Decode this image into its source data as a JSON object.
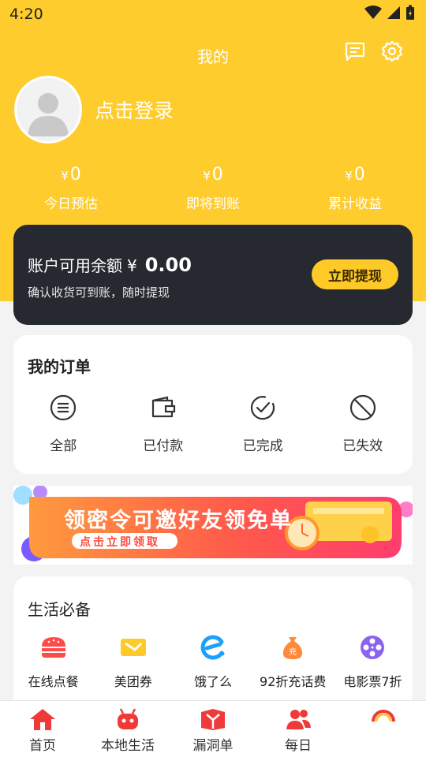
{
  "status_bar": {
    "time": "4:20"
  },
  "header": {
    "title": "我的"
  },
  "user": {
    "login_prompt": "点击登录"
  },
  "stats": [
    {
      "currency": "¥",
      "value": "0",
      "label": "今日预估"
    },
    {
      "currency": "¥",
      "value": "0",
      "label": "即将到账"
    },
    {
      "currency": "¥",
      "value": "0",
      "label": "累计收益"
    }
  ],
  "balance": {
    "title": "账户可用余额",
    "currency": "¥",
    "amount": "0.00",
    "subtitle": "确认收货可到账，随时提现",
    "withdraw_label": "立即提现"
  },
  "orders": {
    "title": "我的订单",
    "items": [
      {
        "label": "全部",
        "icon": "list-icon"
      },
      {
        "label": "已付款",
        "icon": "wallet-icon"
      },
      {
        "label": "已完成",
        "icon": "check-circle-icon"
      },
      {
        "label": "已失效",
        "icon": "ban-icon"
      }
    ]
  },
  "banner": {
    "headline": "领密令可邀好友领免单",
    "cta": "点击立即领取"
  },
  "life": {
    "title": "生活必备",
    "items": [
      {
        "label": "在线点餐",
        "icon": "burger-icon"
      },
      {
        "label": "美团券",
        "icon": "ticket-icon"
      },
      {
        "label": "饿了么",
        "icon": "eleme-icon"
      },
      {
        "label": "92折充话费",
        "icon": "money-bag-icon"
      },
      {
        "label": "电影票7折",
        "icon": "film-reel-icon"
      }
    ]
  },
  "tabs": [
    {
      "label": "首页",
      "icon": "home-icon"
    },
    {
      "label": "本地生活",
      "icon": "robot-icon"
    },
    {
      "label": "漏洞单",
      "icon": "gift-box-icon"
    },
    {
      "label": "每日",
      "icon": "users-icon"
    },
    {
      "label": "",
      "icon": "my-icon"
    }
  ],
  "colors": {
    "header_yellow": "#ffcc2e",
    "card_dark": "#262930",
    "button_yellow": "#ffc928",
    "tab_red": "#f03a3a"
  }
}
